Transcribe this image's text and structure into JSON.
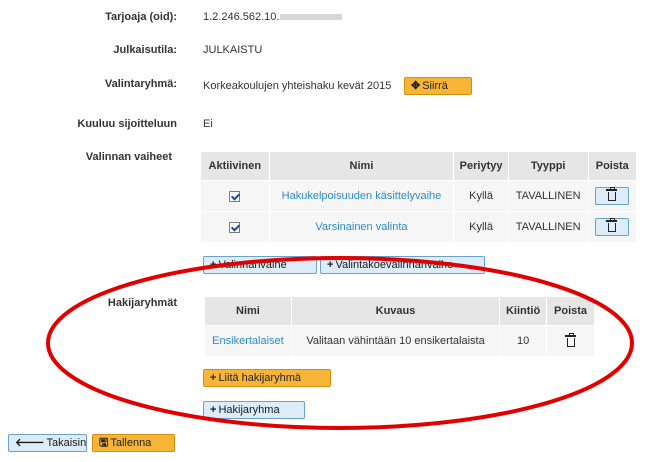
{
  "fields": {
    "tarjoaja_label": "Tarjoaja (oid):",
    "tarjoaja_value": "1.2.246.562.10.",
    "julkaisutila_label": "Julkaisutila:",
    "julkaisutila_value": "JULKAISTU",
    "valintaryhma_label": "Valintaryhmä:",
    "valintaryhma_value": "Korkeakoulujen yhteishaku kevät 2015",
    "siirra_button": "Siirrä",
    "kuuluu_label": "Kuuluu sijoitteluun",
    "kuuluu_value": "Ei",
    "valinnan_vaiheet_label": "Valinnan vaiheet",
    "hakijaryhmat_label": "Hakijaryhmät"
  },
  "phases_table": {
    "headers": {
      "active": "Aktiivinen",
      "name": "Nimi",
      "inherits": "Periytyy",
      "type": "Tyyppi",
      "delete": "Poista"
    },
    "rows": [
      {
        "active": true,
        "name": "Hakukelpoisuuden käsittelyvaihe",
        "inherits": "Kyllä",
        "type": "TAVALLINEN"
      },
      {
        "active": true,
        "name": "Varsinainen valinta",
        "inherits": "Kyllä",
        "type": "TAVALLINEN"
      }
    ],
    "add_phase_button": "Valinnanvaihe",
    "add_exam_phase_button": "Valintakoevalinnanvaihe"
  },
  "groups_table": {
    "headers": {
      "name": "Nimi",
      "description": "Kuvaus",
      "quota": "Kiintiö",
      "delete": "Poista"
    },
    "rows": [
      {
        "name": "Ensikertalaiset",
        "description": "Valitaan vähintään 10 ensikertalaista",
        "quota": "10"
      }
    ],
    "attach_group_button": "Liitä hakijaryhmä",
    "add_group_button": "Hakijaryhma"
  },
  "footer": {
    "back_button": "Takaisin",
    "save_button": "Tallenna"
  },
  "icons": {
    "move": "move-arrows-icon",
    "plus": "plus-icon",
    "trash": "trash-icon",
    "back": "arrow-left-icon",
    "save": "floppy-disk-icon"
  },
  "colors": {
    "orange_button": "#f7b538",
    "blue_button": "#dcecf8",
    "link": "#2a8dc8",
    "annotation_ellipse": "#e00000"
  }
}
